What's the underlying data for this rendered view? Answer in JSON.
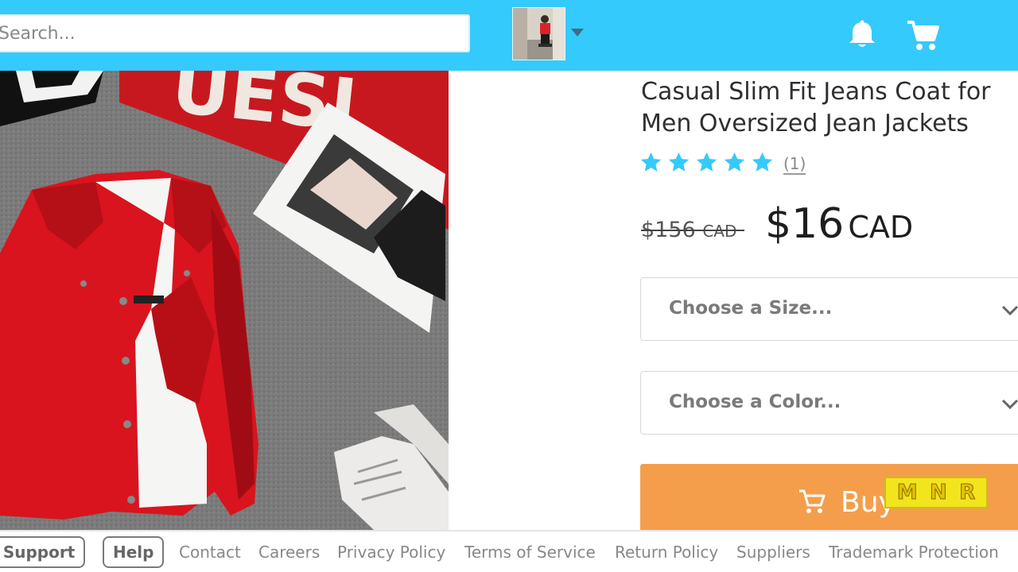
{
  "header": {
    "search_placeholder": "Search...",
    "colors": {
      "bar": "#34cafb"
    },
    "icons": {
      "avatar": "avatar-photo",
      "dropdown": "caret-down-icon",
      "bell": "bell-icon",
      "cart": "cart-icon"
    }
  },
  "product": {
    "title": "Casual Slim Fit Jeans Coat for Men Oversized Jean Jackets",
    "rating": 5,
    "rating_max": 5,
    "review_count": "(1)",
    "old_price": "$156",
    "old_currency": "CAD",
    "price": "$16",
    "currency": "CAD",
    "size_select": "Choose a Size...",
    "color_select": "Choose a Color...",
    "buy_label": "Buy",
    "colors": {
      "star": "#34cafb",
      "buy": "#f49e4c"
    }
  },
  "watermark": {
    "letters": [
      "M",
      "N",
      "R"
    ]
  },
  "footer": {
    "buttons": [
      "r Support",
      "Help"
    ],
    "links": [
      "Contact",
      "Careers",
      "Privacy Policy",
      "Terms of Service",
      "Return Policy",
      "Suppliers",
      "Trademark Protection"
    ]
  }
}
